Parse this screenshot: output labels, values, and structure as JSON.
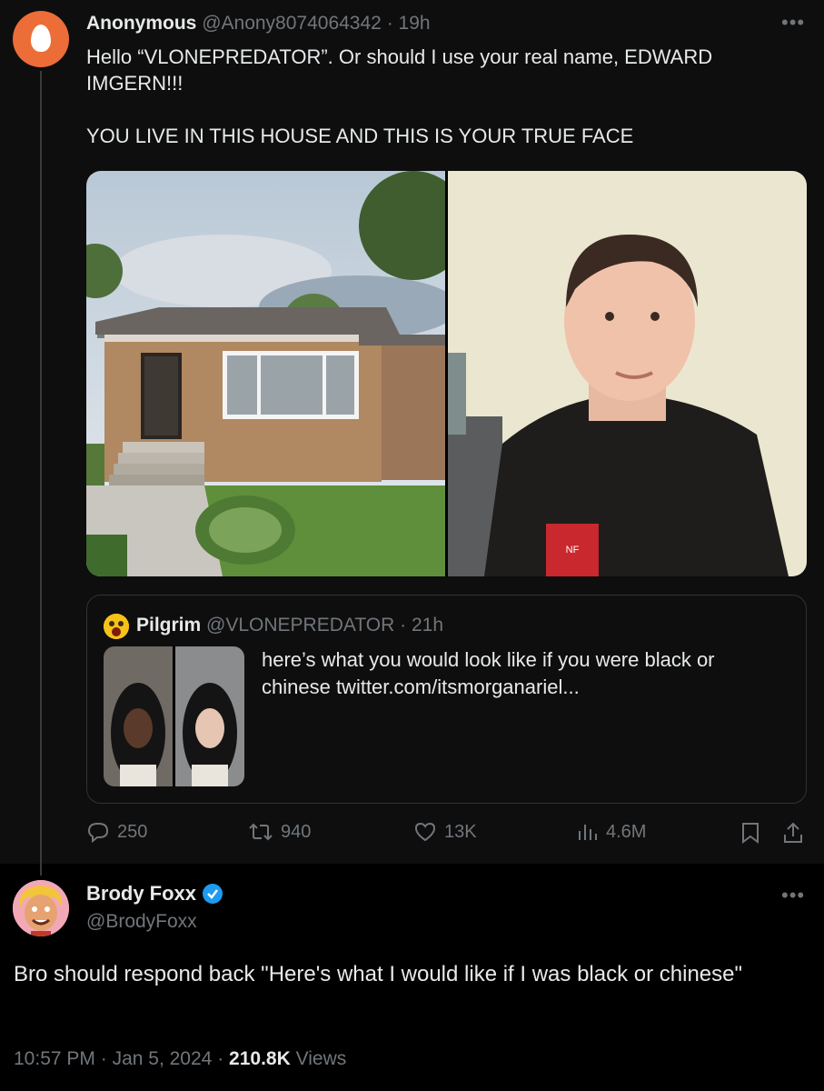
{
  "original": {
    "display_name": "Anonymous",
    "handle": "@Anony8074064342",
    "separator": "·",
    "time": "19h",
    "text": "Hello “VLONEPREDATOR”. Or should I use your real name, EDWARD IMGERN!!!\n\nYOU LIVE IN THIS HOUSE AND THIS IS YOUR TRUE FACE",
    "stats": {
      "replies": "250",
      "reposts": "940",
      "likes": "13K",
      "views": "4.6M"
    }
  },
  "quoted": {
    "display_name": "Pilgrim",
    "handle": "@VLONEPREDATOR",
    "separator": "·",
    "time": "21h",
    "text": "here’s what you would look like if you were black or chinese  twitter.com/itsmorganariel..."
  },
  "reply": {
    "display_name": "Brody Foxx",
    "handle": "@BrodyFoxx",
    "text": "Bro should respond back \"Here's what I would like if I was black or chinese\"",
    "time": "10:57 PM",
    "date": "Jan 5, 2024",
    "separator": "·",
    "views_count": "210.8K",
    "views_label": "Views"
  },
  "icons": [
    "more-icon",
    "reply-icon",
    "repost-icon",
    "like-icon",
    "views-icon",
    "bookmark-icon",
    "share-icon",
    "verified-badge-icon"
  ],
  "colors": {
    "background": "#000000",
    "text": "#e7e9ea",
    "muted": "#71767b",
    "verified": "#1d9bf0",
    "anon_avatar": "#ec6d37"
  }
}
